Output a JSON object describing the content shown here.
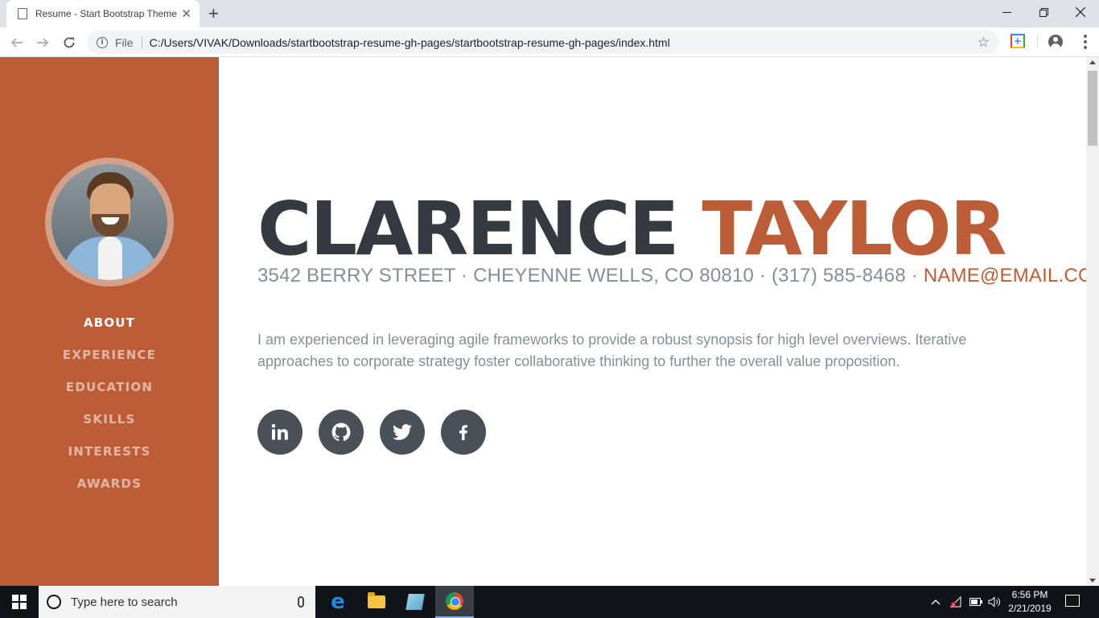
{
  "browser": {
    "tab_title": "Resume - Start Bootstrap Theme",
    "new_tab_symbol": "+",
    "scheme_label": "File",
    "url": "C:/Users/VIVAK/Downloads/startbootstrap-resume-gh-pages/startbootstrap-resume-gh-pages/index.html",
    "icons": [
      "page-icon",
      "tab-close-icon",
      "back-arrow-icon",
      "forward-arrow-icon",
      "reload-icon",
      "info-icon",
      "bookmark-star-icon",
      "extension-icon",
      "profile-icon",
      "menu-kebab-icon",
      "minimize-icon",
      "maximize-icon",
      "window-close-icon"
    ]
  },
  "sidebar": {
    "color": "#bd5d38",
    "nav": [
      {
        "label": "ABOUT",
        "active": true
      },
      {
        "label": "EXPERIENCE",
        "active": false
      },
      {
        "label": "EDUCATION",
        "active": false
      },
      {
        "label": "SKILLS",
        "active": false
      },
      {
        "label": "INTERESTS",
        "active": false
      },
      {
        "label": "AWARDS",
        "active": false
      }
    ]
  },
  "about": {
    "first_name": "CLARENCE",
    "last_name": "TAYLOR",
    "address": "3542 BERRY STREET · CHEYENNE WELLS, CO 80810 · (317) 585-8468 · ",
    "email": "NAME@EMAIL.COM",
    "bio": "I am experienced in leveraging agile frameworks to provide a robust synopsis for high level overviews. Iterative approaches to corporate strategy foster collaborative thinking to further the overall value proposition.",
    "socials": [
      "linkedin-icon",
      "github-icon",
      "twitter-icon",
      "facebook-icon"
    ]
  },
  "taskbar": {
    "search_placeholder": "Type here to search",
    "time": "6:56 PM",
    "date": "2/21/2019"
  },
  "colors": {
    "accent": "#bd5d38",
    "heading": "#343a40",
    "muted": "#868e96",
    "social_bg": "#495057"
  }
}
